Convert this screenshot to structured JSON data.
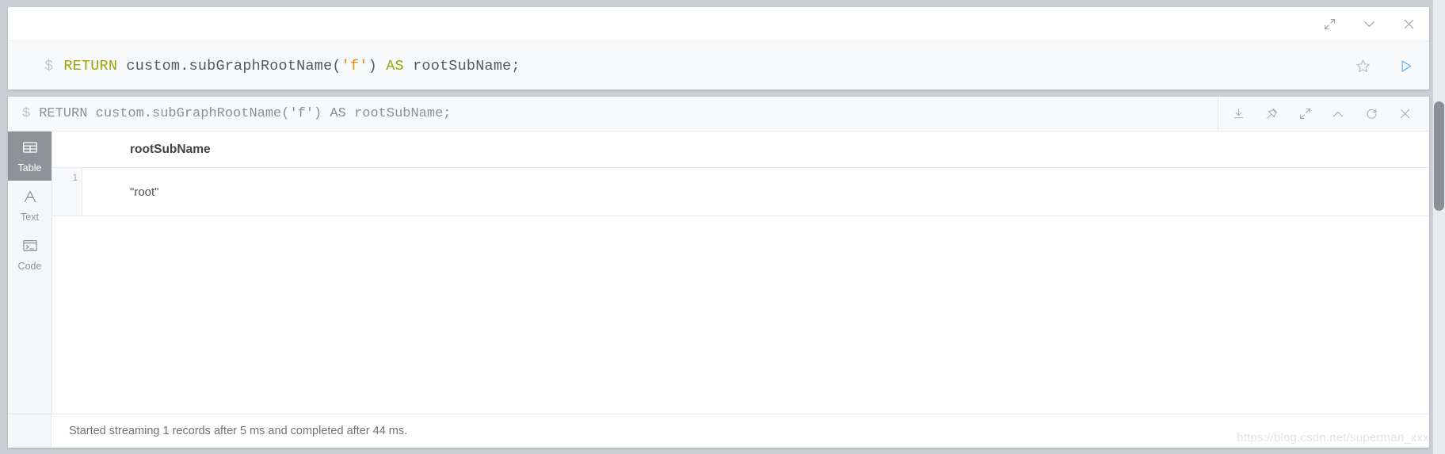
{
  "editor": {
    "prompt": "$",
    "query_tokens": [
      {
        "text": "RETURN",
        "kind": "kw"
      },
      {
        "text": " custom.subGraphRootName(",
        "kind": "plain"
      },
      {
        "text": "'f'",
        "kind": "str"
      },
      {
        "text": ") ",
        "kind": "plain"
      },
      {
        "text": "AS",
        "kind": "kw"
      },
      {
        "text": " rootSubName;",
        "kind": "plain"
      }
    ],
    "query_plain": "RETURN custom.subGraphRootName('f') AS rootSubName;",
    "titlebar_icons": [
      {
        "name": "expand-icon",
        "glyph": "expand"
      },
      {
        "name": "chevron-down-icon",
        "glyph": "chevron-down"
      },
      {
        "name": "close-icon",
        "glyph": "close"
      }
    ],
    "favorite_icon": "star-icon",
    "run_icon": "play-icon",
    "colors": {
      "keyword": "#9ba700",
      "string": "#d9911a",
      "plain": "#55595e",
      "prompt": "#bfc5cc",
      "run": "#68b3e8"
    }
  },
  "frame": {
    "prompt": "$",
    "query": "RETURN custom.subGraphRootName('f') AS rootSubName;",
    "header_icons": [
      {
        "name": "download-icon",
        "glyph": "download"
      },
      {
        "name": "pin-icon",
        "glyph": "pin"
      },
      {
        "name": "expand-icon",
        "glyph": "expand"
      },
      {
        "name": "chevron-up-icon",
        "glyph": "chevron-up"
      },
      {
        "name": "refresh-icon",
        "glyph": "refresh"
      },
      {
        "name": "close-icon",
        "glyph": "close"
      }
    ],
    "tabs": [
      {
        "label": "Table",
        "icon": "table-icon",
        "active": true
      },
      {
        "label": "Text",
        "icon": "text-icon",
        "active": false
      },
      {
        "label": "Code",
        "icon": "code-icon",
        "active": false
      }
    ],
    "table": {
      "columns": [
        "rootSubName"
      ],
      "rows": [
        {
          "index": "1",
          "values": [
            "\"root\""
          ]
        }
      ]
    },
    "status": "Started streaming 1 records after 5 ms and completed after 44 ms."
  },
  "watermark": "https://blog.csdn.net/superman_xxx"
}
